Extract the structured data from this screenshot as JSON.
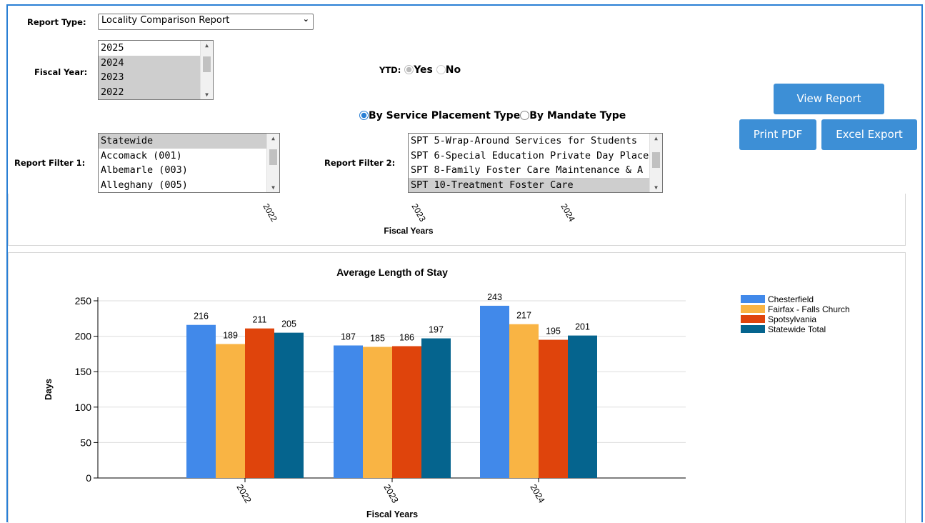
{
  "report_type": {
    "label": "Report Type:",
    "selected": "Locality Comparison Report"
  },
  "fiscal_year": {
    "label": "Fiscal Year:",
    "options": [
      "2025",
      "2024",
      "2023",
      "2022"
    ]
  },
  "ytd": {
    "label": "YTD:",
    "yes": "Yes",
    "no": "No"
  },
  "grouping": {
    "by_spt": "By Service Placement Type",
    "by_mandate": "By Mandate Type"
  },
  "filter1": {
    "label": "Report Filter 1:",
    "options": [
      "Statewide",
      "Accomack (001)",
      "Albemarle (003)",
      "Alleghany (005)"
    ]
  },
  "filter2": {
    "label": "Report Filter 2:",
    "options": [
      "SPT 5-Wrap-Around Services for Students",
      "SPT 6-Special Education Private Day Place",
      "SPT 8-Family Foster Care Maintenance & A",
      "SPT 10-Treatment Foster Care"
    ]
  },
  "buttons": {
    "view": "View Report",
    "pdf": "Print PDF",
    "excel": "Excel Export"
  },
  "upper_chart_fragment": {
    "ticks": [
      "2022",
      "2023",
      "2024"
    ],
    "xlabel": "Fiscal Years"
  },
  "colors": {
    "accent": "#3d8fd6",
    "chesterfield": "#4189ea",
    "fairfax": "#f9b444",
    "spotsylvania": "#df440c",
    "statewide": "#05648e"
  },
  "chart_data": {
    "type": "bar",
    "title": "Average Length of Stay",
    "xlabel": "Fiscal Years",
    "ylabel": "Days",
    "ylim": [
      0,
      250
    ],
    "yticks": [
      0,
      50,
      100,
      150,
      200,
      250
    ],
    "categories": [
      "2022",
      "2023",
      "2024"
    ],
    "series": [
      {
        "name": "Chesterfield",
        "values": [
          216,
          187,
          243
        ],
        "color": "#4189ea"
      },
      {
        "name": "Fairfax - Falls Church",
        "values": [
          189,
          185,
          217
        ],
        "color": "#f9b444"
      },
      {
        "name": "Spotsylvania",
        "values": [
          211,
          186,
          195
        ],
        "color": "#df440c"
      },
      {
        "name": "Statewide Total",
        "values": [
          205,
          197,
          201
        ],
        "color": "#05648e"
      }
    ],
    "grid": true,
    "legend": "right"
  }
}
